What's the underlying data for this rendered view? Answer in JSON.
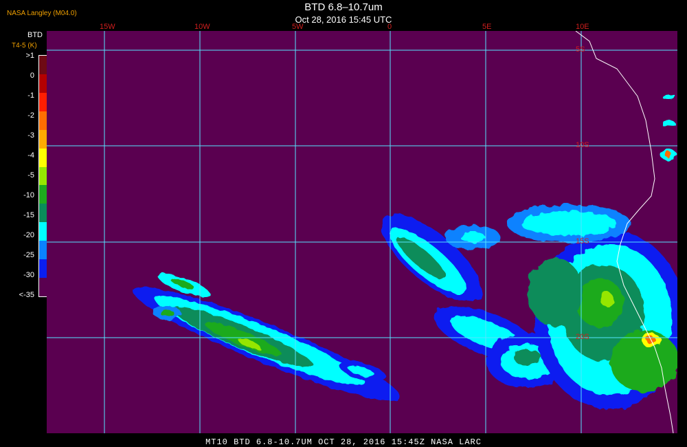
{
  "header": {
    "source": "NASA Langley (M04.0)",
    "title": "BTD 6.8–10.7um",
    "subtitle": "Oct 28, 2016 15:45 UTC"
  },
  "legend": {
    "title": "BTD",
    "unit": "T4-5 (K)",
    "entries": [
      {
        "label": ">1",
        "color": "#6e0a14"
      },
      {
        "label": "0",
        "color": "#b40000"
      },
      {
        "label": "-1",
        "color": "#ff1e00"
      },
      {
        "label": "-2",
        "color": "#ff6e00"
      },
      {
        "label": "-3",
        "color": "#ffaa00"
      },
      {
        "label": "-4",
        "color": "#ffff00"
      },
      {
        "label": "-5",
        "color": "#96e600"
      },
      {
        "label": "-10",
        "color": "#1eaa1e"
      },
      {
        "label": "-15",
        "color": "#0a8c5a"
      },
      {
        "label": "-20",
        "color": "#00ffff"
      },
      {
        "label": "-25",
        "color": "#0a82ff"
      },
      {
        "label": "-30",
        "color": "#0a1ef0"
      },
      {
        "label": "<-35",
        "color": "#5a0050"
      }
    ]
  },
  "map": {
    "lon_labels": [
      "15W",
      "10W",
      "5W",
      "0",
      "5E",
      "10E"
    ],
    "lat_labels": [
      "5S",
      "10S",
      "15S",
      "20S"
    ],
    "grid_color": "#55e6ff",
    "background_color": "#5a0050",
    "coastline_color": "#ffffff"
  },
  "footer": {
    "text": "MT10  BTD 6.8-10.7UM   OCT 28, 2016 15:45Z   NASA LARC"
  }
}
